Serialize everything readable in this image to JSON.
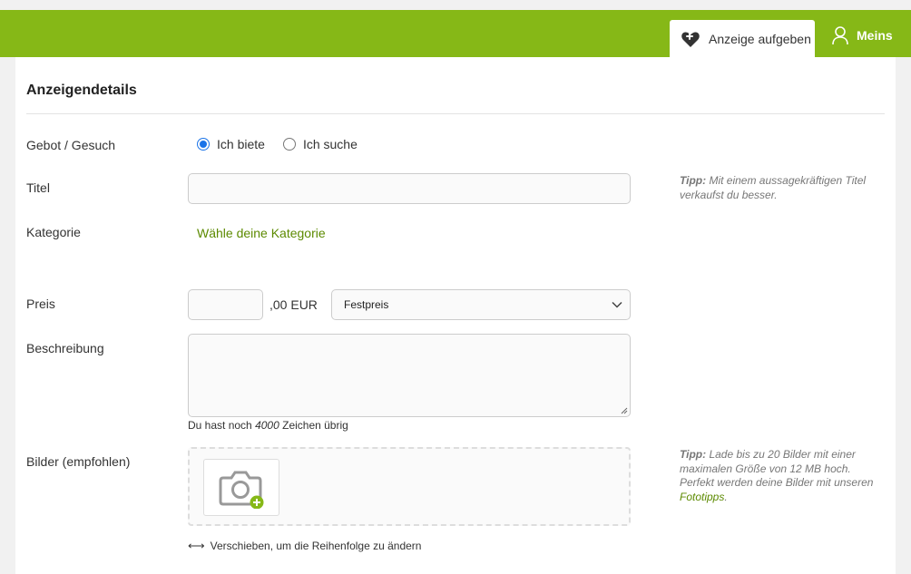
{
  "header": {
    "post_ad_label": "Anzeige aufgeben",
    "account_label": "Meins",
    "brand_color": "#86b817"
  },
  "section": {
    "title": "Anzeigendetails"
  },
  "form": {
    "offer_type": {
      "label": "Gebot / Gesuch",
      "options": [
        {
          "label": "Ich biete",
          "checked": true
        },
        {
          "label": "Ich suche",
          "checked": false
        }
      ]
    },
    "title": {
      "label": "Titel",
      "value": "",
      "tip_bold": "Tipp:",
      "tip_text": "Mit einem aussagekräftigen Titel verkaufst du besser."
    },
    "category": {
      "label": "Kategorie",
      "link_text": "Wähle deine Kategorie"
    },
    "price": {
      "label": "Preis",
      "value": "",
      "suffix": ",00 EUR",
      "type_selected": "Festpreis"
    },
    "description": {
      "label": "Beschreibung",
      "value": "",
      "chars_prefix": "Du hast noch",
      "chars_count": "4000",
      "chars_suffix": "Zeichen übrig"
    },
    "images": {
      "label": "Bilder (empfohlen)",
      "tip_bold": "Tipp:",
      "tip_text": "Lade bis zu 20 Bilder mit einer maximalen Größe von 12 MB hoch. Perfekt werden deine Bilder mit unseren",
      "tip_link": "Fototipps",
      "tip_end": ".",
      "reorder_hint": "Verschieben, um die Reihenfolge zu ändern"
    }
  }
}
